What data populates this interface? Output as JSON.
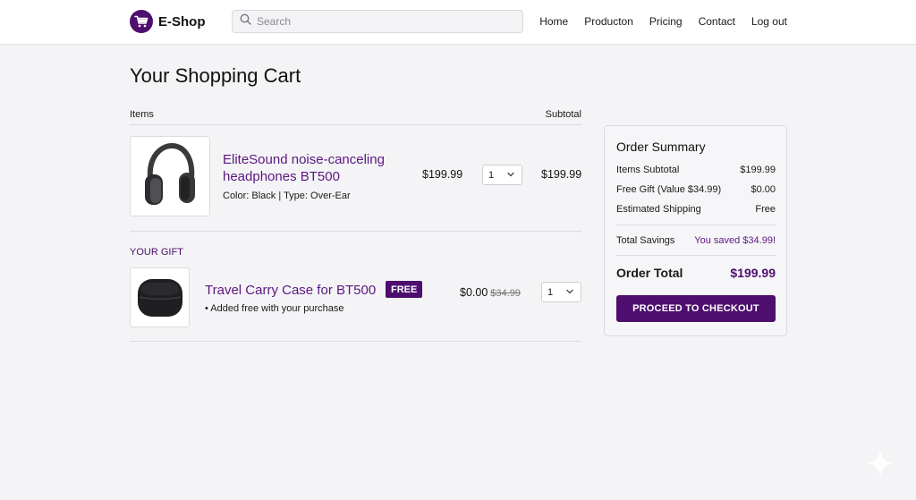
{
  "header": {
    "brand": "E-Shop",
    "search_placeholder": "Search",
    "nav": [
      "Home",
      "Producton",
      "Pricing",
      "Contact",
      "Log out"
    ]
  },
  "page": {
    "title": "Your Shopping Cart"
  },
  "cart": {
    "col_items": "Items",
    "col_subtotal": "Subtotal",
    "item": {
      "name": "EliteSound noise-canceling headphones BT500",
      "meta": "Color: Black | Type: Over-Ear",
      "price": "$199.99",
      "qty": "1",
      "subtotal": "$199.99",
      "image_icon": "headphones-image"
    },
    "gift_label": "YOUR GIFT",
    "gift": {
      "name": "Travel Carry Case for BT500",
      "badge": "FREE",
      "note": "• Added free with your purchase",
      "price": "$0.00",
      "original_price": "$34.99",
      "qty": "1",
      "image_icon": "carry-case-image"
    }
  },
  "summary": {
    "title": "Order Summary",
    "items_subtotal_label": "Items Subtotal",
    "items_subtotal": "$199.99",
    "free_gift_label": "Free Gift (Value $34.99)",
    "free_gift": "$0.00",
    "shipping_label": "Estimated Shipping",
    "shipping": "Free",
    "savings_label": "Total Savings",
    "savings": "You saved $34.99!",
    "total_label": "Order Total",
    "total": "$199.99",
    "checkout_label": "PROCEED TO CHECKOUT"
  },
  "colors": {
    "brand": "#4d0e6e",
    "link": "#5b1780",
    "background": "#f4f4f6"
  }
}
